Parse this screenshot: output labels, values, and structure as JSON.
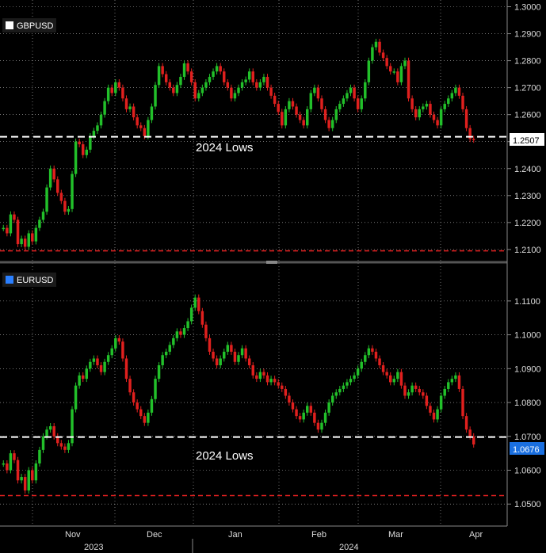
{
  "chart_data": [
    {
      "type": "candlestick",
      "series_name": "GBPUSD",
      "legend_color": "#ffffff",
      "ylim": [
        1.2085,
        1.3025
      ],
      "y_ticks": [
        1.21,
        1.22,
        1.23,
        1.24,
        1.25,
        1.26,
        1.27,
        1.28,
        1.29,
        1.3
      ],
      "y_tick_labels": [
        "1.2100",
        "1.2200",
        "1.2300",
        "1.2400",
        "1.2500",
        "1.2600",
        "1.2700",
        "1.2800",
        "1.2900",
        "1.3000"
      ],
      "last_price": 1.2507,
      "last_price_label": "1.2507",
      "support_level": 1.2518,
      "support_label": "2024 Lows",
      "floor_level": 1.2095,
      "closes": [
        1.218,
        1.216,
        1.223,
        1.221,
        1.212,
        1.214,
        1.211,
        1.216,
        1.213,
        1.218,
        1.221,
        1.224,
        1.233,
        1.24,
        1.236,
        1.231,
        1.228,
        1.224,
        1.225,
        1.238,
        1.25,
        1.249,
        1.245,
        1.247,
        1.252,
        1.254,
        1.256,
        1.26,
        1.265,
        1.27,
        1.268,
        1.272,
        1.27,
        1.266,
        1.262,
        1.263,
        1.259,
        1.256,
        1.255,
        1.252,
        1.258,
        1.263,
        1.271,
        1.278,
        1.275,
        1.272,
        1.27,
        1.268,
        1.271,
        1.274,
        1.279,
        1.276,
        1.272,
        1.266,
        1.268,
        1.27,
        1.272,
        1.274,
        1.276,
        1.278,
        1.276,
        1.272,
        1.27,
        1.266,
        1.268,
        1.27,
        1.272,
        1.273,
        1.276,
        1.272,
        1.27,
        1.272,
        1.274,
        1.27,
        1.267,
        1.264,
        1.261,
        1.256,
        1.262,
        1.265,
        1.263,
        1.26,
        1.258,
        1.256,
        1.262,
        1.268,
        1.27,
        1.266,
        1.262,
        1.258,
        1.255,
        1.258,
        1.262,
        1.264,
        1.266,
        1.268,
        1.27,
        1.266,
        1.262,
        1.266,
        1.272,
        1.28,
        1.285,
        1.287,
        1.283,
        1.281,
        1.278,
        1.276,
        1.276,
        1.272,
        1.278,
        1.28,
        1.266,
        1.262,
        1.259,
        1.262,
        1.263,
        1.264,
        1.26,
        1.258,
        1.256,
        1.262,
        1.264,
        1.266,
        1.268,
        1.27,
        1.267,
        1.262,
        1.255,
        1.251,
        1.2507
      ]
    },
    {
      "type": "candlestick",
      "series_name": "EURUSD",
      "legend_color": "#2a7fff",
      "ylim": [
        1.0435,
        1.1205
      ],
      "y_ticks": [
        1.05,
        1.06,
        1.07,
        1.08,
        1.09,
        1.1,
        1.11
      ],
      "y_tick_labels": [
        "1.0500",
        "1.0600",
        "1.0700",
        "1.0800",
        "1.0900",
        "1.1000",
        "1.1100"
      ],
      "last_price": 1.0676,
      "last_price_label": "1.0676",
      "support_level": 1.0698,
      "support_label": "2024 Lows",
      "floor_level": 1.0525,
      "closes": [
        1.062,
        1.06,
        1.065,
        1.063,
        1.057,
        1.058,
        1.054,
        1.06,
        1.057,
        1.062,
        1.066,
        1.07,
        1.072,
        1.073,
        1.07,
        1.068,
        1.067,
        1.066,
        1.068,
        1.078,
        1.085,
        1.088,
        1.087,
        1.09,
        1.092,
        1.093,
        1.091,
        1.089,
        1.092,
        1.094,
        1.096,
        1.099,
        1.098,
        1.093,
        1.087,
        1.083,
        1.08,
        1.078,
        1.076,
        1.074,
        1.077,
        1.081,
        1.087,
        1.091,
        1.094,
        1.095,
        1.097,
        1.099,
        1.101,
        1.1,
        1.102,
        1.104,
        1.108,
        1.111,
        1.107,
        1.103,
        1.099,
        1.095,
        1.093,
        1.091,
        1.093,
        1.095,
        1.097,
        1.095,
        1.092,
        1.094,
        1.096,
        1.093,
        1.091,
        1.088,
        1.087,
        1.089,
        1.088,
        1.086,
        1.087,
        1.086,
        1.085,
        1.084,
        1.082,
        1.08,
        1.078,
        1.076,
        1.075,
        1.077,
        1.079,
        1.077,
        1.074,
        1.072,
        1.074,
        1.077,
        1.08,
        1.082,
        1.083,
        1.084,
        1.085,
        1.086,
        1.087,
        1.088,
        1.09,
        1.092,
        1.094,
        1.096,
        1.095,
        1.093,
        1.091,
        1.089,
        1.088,
        1.086,
        1.087,
        1.089,
        1.085,
        1.082,
        1.083,
        1.085,
        1.084,
        1.083,
        1.082,
        1.079,
        1.077,
        1.075,
        1.078,
        1.082,
        1.084,
        1.086,
        1.087,
        1.088,
        1.084,
        1.076,
        1.072,
        1.07,
        1.0676
      ]
    }
  ],
  "x_axis": {
    "months": [
      "Nov",
      "Dec",
      "Jan",
      "Feb",
      "Mar",
      "Apr"
    ],
    "years": [
      "2023",
      "2024"
    ]
  },
  "colors": {
    "up": "#22c02a",
    "down": "#e0201e",
    "support_line": "#ffffff",
    "floor_line": "#e02020",
    "grid": "#bbbbbb",
    "background": "#000000",
    "price_box": "#ffffff",
    "price_box_eur": "#1a6fe0"
  }
}
